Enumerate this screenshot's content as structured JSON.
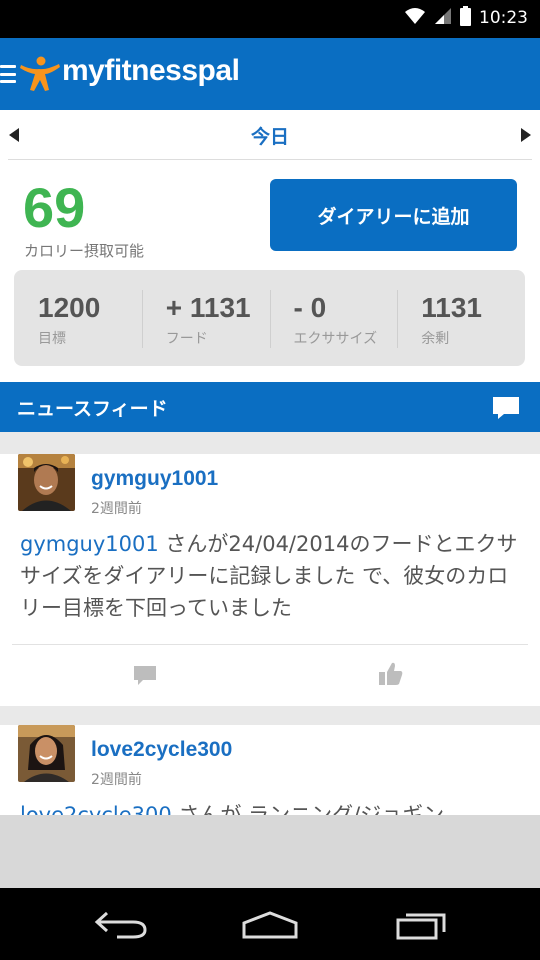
{
  "status_bar": {
    "time": "10:23"
  },
  "app": {
    "title": "myfitnesspal",
    "brand_color": "#0a6ec2"
  },
  "day_nav": {
    "label": "今日"
  },
  "summary": {
    "calories_remaining": "69",
    "calories_label": "カロリー摂取可能",
    "add_button": "ダイアリーに追加",
    "equation": [
      {
        "value": "1200",
        "label": "目標"
      },
      {
        "value": "+ 1131",
        "label": "フード"
      },
      {
        "value": "- 0",
        "label": "エクササイズ"
      },
      {
        "value": "1131",
        "label": "余剰"
      }
    ]
  },
  "newsfeed": {
    "title": "ニュースフィード",
    "posts": [
      {
        "username": "gymguy1001",
        "time_ago": "2週間前",
        "text_user": "gymguy1001",
        "text_body": " さんが24/04/2014のフードとエクササイズをダイアリーに記録しました で、彼女のカロリー目標を下回っていました"
      },
      {
        "username": "love2cycle300",
        "time_ago": "2週間前",
        "text_user": "love2cycle300",
        "text_body": " さんが ランニング/ジョギン"
      }
    ]
  }
}
